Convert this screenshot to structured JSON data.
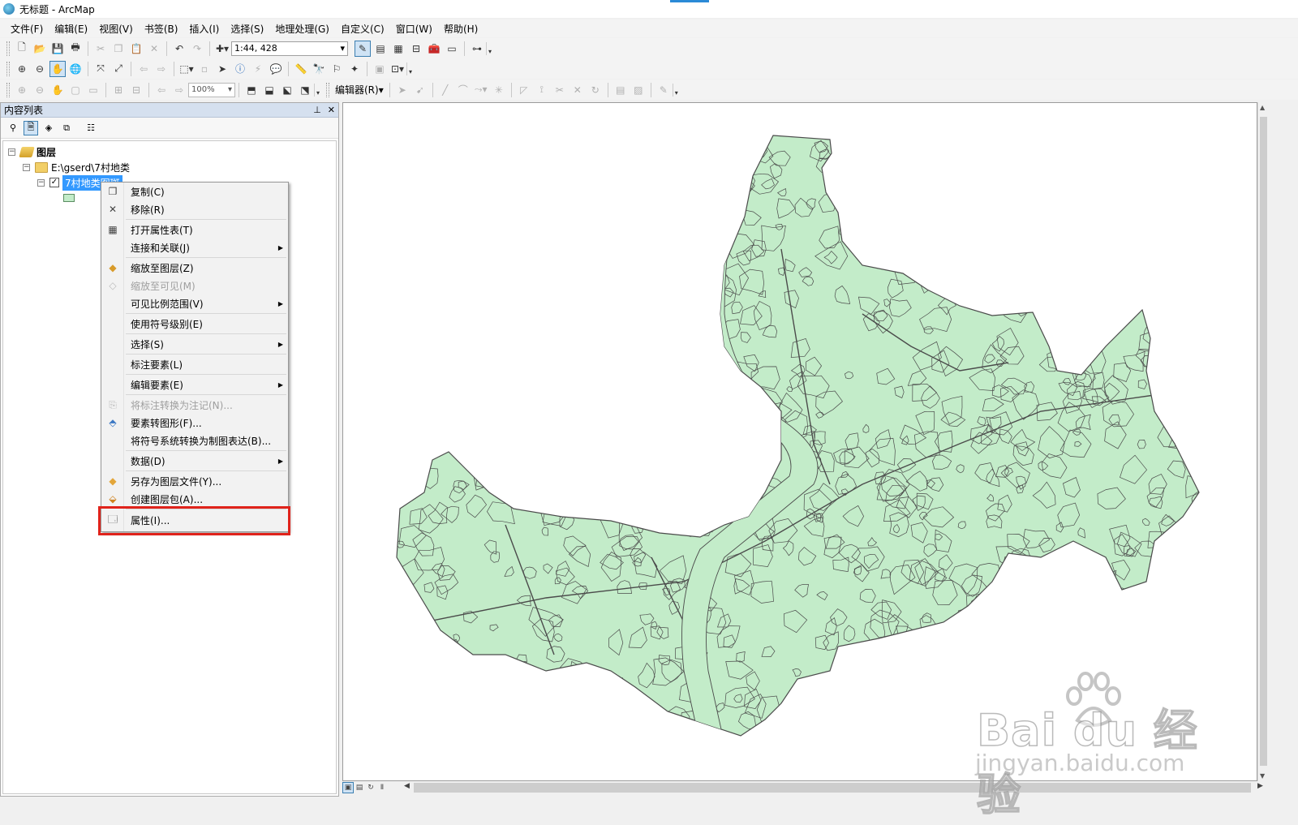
{
  "window": {
    "title": "无标题 - ArcMap"
  },
  "menubar": [
    "文件(F)",
    "编辑(E)",
    "视图(V)",
    "书签(B)",
    "插入(I)",
    "选择(S)",
    "地理处理(G)",
    "自定义(C)",
    "窗口(W)",
    "帮助(H)"
  ],
  "toolbar": {
    "scale": "1:44, 428",
    "zoom": "100%",
    "editor_label": "编辑器(R)▾"
  },
  "toc": {
    "title": "内容列表",
    "tree": {
      "root": "图层",
      "folder": "E:\\gserd\\7村地类",
      "layer": "7村地类图斑"
    }
  },
  "context_menu": {
    "items": [
      {
        "label": "复制(C)",
        "icon": "copy-icon",
        "enabled": true
      },
      {
        "label": "移除(R)",
        "icon": "remove-icon",
        "enabled": true
      },
      {
        "label": "打开属性表(T)",
        "icon": "table-icon",
        "enabled": true
      },
      {
        "label": "连接和关联(J)",
        "icon": "",
        "enabled": true,
        "submenu": true
      },
      {
        "label": "缩放至图层(Z)",
        "icon": "zoom-layer-icon",
        "enabled": true
      },
      {
        "label": "缩放至可见(M)",
        "icon": "zoom-visible-icon",
        "enabled": false
      },
      {
        "label": "可见比例范围(V)",
        "icon": "",
        "enabled": true,
        "submenu": true
      },
      {
        "label": "使用符号级别(E)",
        "icon": "",
        "enabled": true
      },
      {
        "label": "选择(S)",
        "icon": "",
        "enabled": true,
        "submenu": true
      },
      {
        "label": "标注要素(L)",
        "icon": "",
        "enabled": true
      },
      {
        "label": "编辑要素(E)",
        "icon": "",
        "enabled": true,
        "submenu": true
      },
      {
        "label": "将标注转换为注记(N)...",
        "icon": "convert-labels-icon",
        "enabled": false
      },
      {
        "label": "要素转图形(F)...",
        "icon": "features-to-graphics-icon",
        "enabled": true
      },
      {
        "label": "将符号系统转换为制图表达(B)...",
        "icon": "",
        "enabled": true
      },
      {
        "label": "数据(D)",
        "icon": "",
        "enabled": true,
        "submenu": true
      },
      {
        "label": "另存为图层文件(Y)...",
        "icon": "layer-file-icon",
        "enabled": true
      },
      {
        "label": "创建图层包(A)...",
        "icon": "layer-package-icon",
        "enabled": true
      },
      {
        "label": "属性(I)...",
        "icon": "properties-icon",
        "enabled": true,
        "highlighted": true
      }
    ]
  },
  "map": {
    "fill_color": "#c3ecc9",
    "line_color": "#4b4b4b"
  },
  "watermark": {
    "brand": "Bai du 经验",
    "url": "jingyan.baidu.com"
  },
  "colors": {
    "highlight_box": "#e0231b",
    "selection": "#3399ff",
    "toc_header": "#d5e0ef"
  }
}
